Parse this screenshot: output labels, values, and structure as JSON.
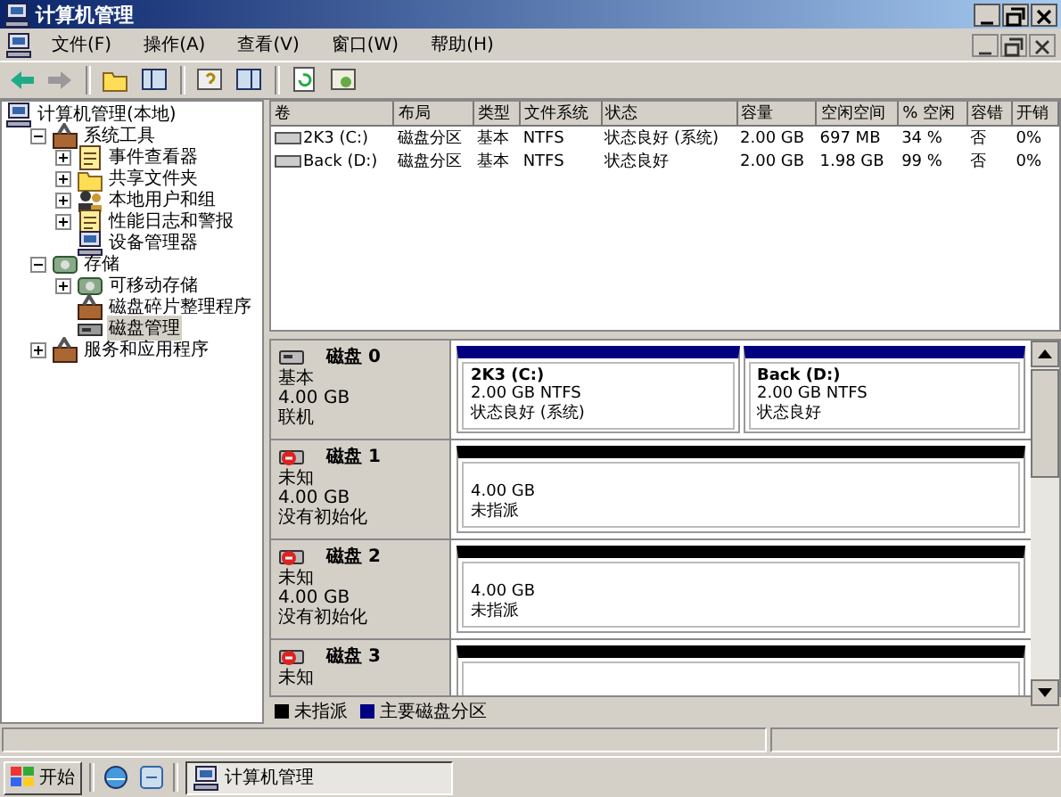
{
  "window": {
    "title": "计算机管理"
  },
  "menu": [
    "文件(F)",
    "操作(A)",
    "查看(V)",
    "窗口(W)",
    "帮助(H)"
  ],
  "tree": [
    {
      "label": "计算机管理(本地)",
      "selected": false,
      "children": [
        {
          "label": "系统工具",
          "expanded": true,
          "selected": false,
          "children": [
            {
              "label": "事件查看器",
              "expanded": false,
              "selected": false
            },
            {
              "label": "共享文件夹",
              "expanded": false,
              "selected": false
            },
            {
              "label": "本地用户和组",
              "expanded": false,
              "selected": false
            },
            {
              "label": "性能日志和警报",
              "expanded": false,
              "selected": false
            },
            {
              "label": "设备管理器",
              "selected": false
            }
          ]
        },
        {
          "label": "存储",
          "expanded": true,
          "selected": false,
          "children": [
            {
              "label": "可移动存储",
              "expanded": false,
              "selected": false
            },
            {
              "label": "磁盘碎片整理程序",
              "selected": false
            },
            {
              "label": "磁盘管理",
              "selected": true
            }
          ]
        },
        {
          "label": "服务和应用程序",
          "expanded": false,
          "selected": false
        }
      ]
    }
  ],
  "table": {
    "columns": [
      "卷",
      "布局",
      "类型",
      "文件系统",
      "状态",
      "容量",
      "空闲空间",
      "% 空闲",
      "容错",
      "开销"
    ],
    "rows": [
      [
        "2K3  (C:)",
        "磁盘分区",
        "基本",
        "NTFS",
        "状态良好 (系统)",
        "2.00 GB",
        "697 MB",
        "34 %",
        "否",
        "0%"
      ],
      [
        "Back  (D:)",
        "磁盘分区",
        "基本",
        "NTFS",
        "状态良好",
        "2.00 GB",
        "1.98 GB",
        "99 %",
        "否",
        "0%"
      ]
    ]
  },
  "disks": [
    {
      "name": "磁盘 0",
      "kind": "online",
      "lines": [
        "基本",
        "4.00 GB",
        "联机"
      ],
      "partitions": [
        {
          "kind": "primary",
          "title": "2K3  (C:)",
          "lines": [
            "2.00 GB NTFS",
            "状态良好 (系统)"
          ]
        },
        {
          "kind": "primary",
          "title": "Back  (D:)",
          "lines": [
            "2.00 GB NTFS",
            "状态良好"
          ]
        }
      ]
    },
    {
      "name": "磁盘 1",
      "kind": "unknown",
      "lines": [
        "未知",
        "4.00 GB",
        "没有初始化"
      ],
      "partitions": [
        {
          "kind": "unallocated",
          "lines": [
            "4.00 GB",
            "未指派"
          ]
        }
      ]
    },
    {
      "name": "磁盘 2",
      "kind": "unknown",
      "lines": [
        "未知",
        "4.00 GB",
        "没有初始化"
      ],
      "partitions": [
        {
          "kind": "unallocated",
          "lines": [
            "4.00 GB",
            "未指派"
          ]
        }
      ]
    },
    {
      "name": "磁盘 3",
      "kind": "unknown",
      "lines": [
        "未知"
      ],
      "partitions": [
        {
          "kind": "unallocated"
        }
      ]
    }
  ],
  "legend": [
    {
      "label": "未指派",
      "color": "#000000"
    },
    {
      "label": "主要磁盘分区",
      "color": "#000080"
    }
  ],
  "taskbar": {
    "start": "开始",
    "tasks": [
      {
        "label": "计算机管理",
        "selected": true
      }
    ]
  }
}
